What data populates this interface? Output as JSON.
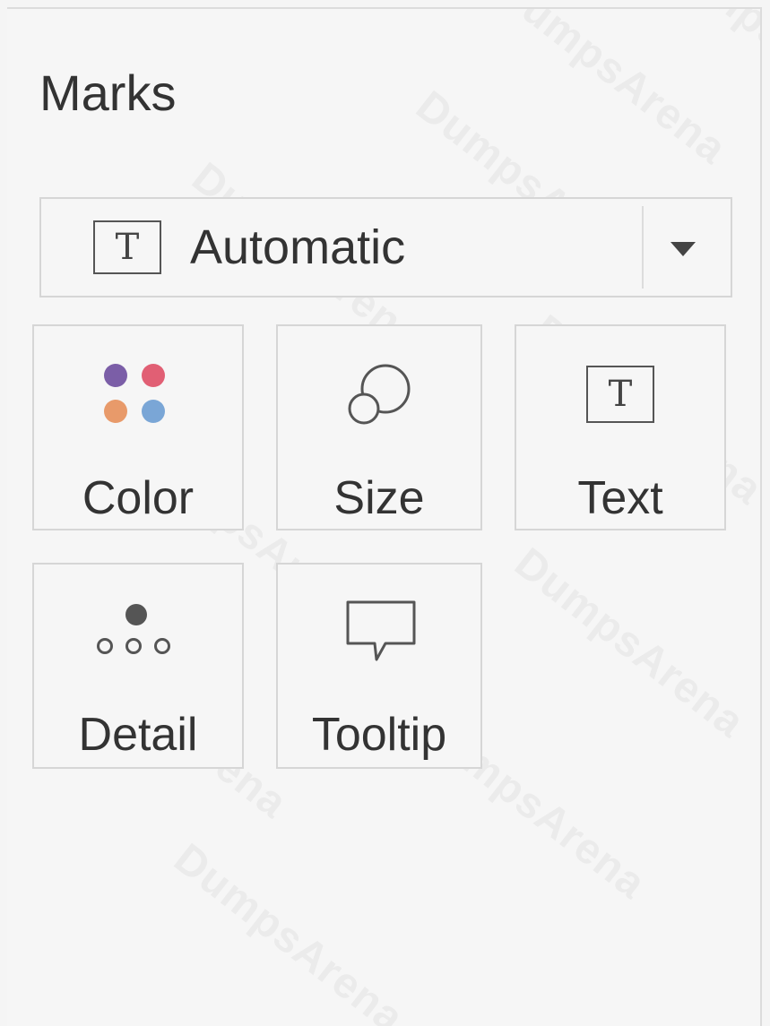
{
  "marks_card": {
    "title": "Marks",
    "mark_type": {
      "selected": "Automatic",
      "icon": "text-T-icon",
      "dropdown_icon": "caret-down-icon"
    },
    "properties": [
      {
        "key": "color",
        "label": "Color",
        "icon": "color-dots-icon"
      },
      {
        "key": "size",
        "label": "Size",
        "icon": "size-circles-icon"
      },
      {
        "key": "text",
        "label": "Text",
        "icon": "text-T-icon"
      },
      {
        "key": "detail",
        "label": "Detail",
        "icon": "detail-dots-icon"
      },
      {
        "key": "tooltip",
        "label": "Tooltip",
        "icon": "speech-bubble-icon"
      }
    ]
  },
  "watermark": "DumpsArena",
  "colors": {
    "color_dot_purple": "#7b5ea7",
    "color_dot_red": "#e15f74",
    "color_dot_orange": "#e89a6a",
    "color_dot_blue": "#7aa6d6",
    "icon_gray": "#555555"
  }
}
